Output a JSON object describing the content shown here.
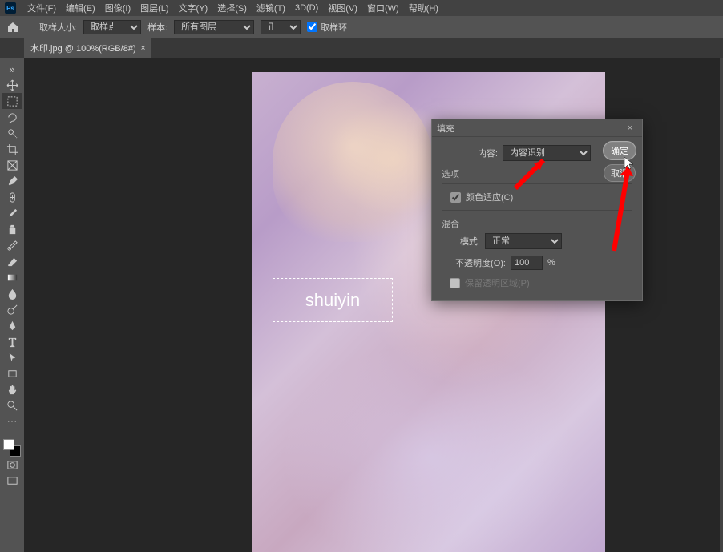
{
  "menu": {
    "items": [
      "文件(F)",
      "编辑(E)",
      "图像(I)",
      "图层(L)",
      "文字(Y)",
      "选择(S)",
      "滤镜(T)",
      "3D(D)",
      "视图(V)",
      "窗口(W)",
      "帮助(H)"
    ]
  },
  "optionsbar": {
    "sample_size_label": "取样大小:",
    "sample_size_value": "取样点",
    "sample_label": "样本:",
    "sample_value": "所有图层",
    "mode_value": "正常",
    "ring_label": "取样环"
  },
  "tab": {
    "label": "水印.jpg @ 100%(RGB/8#)"
  },
  "watermark_text": "shuiyin",
  "dialog": {
    "title": "填充",
    "content_label": "内容:",
    "content_value": "内容识别",
    "options_label": "选项",
    "color_adapt_label": "颜色适应(C)",
    "color_adapt_checked": true,
    "blend_label": "混合",
    "mode_label": "模式:",
    "mode_value": "正常",
    "opacity_label": "不透明度(O):",
    "opacity_value": "100",
    "opacity_unit": "%",
    "preserve_label": "保留透明区域(P)",
    "ok": "确定",
    "cancel": "取消"
  },
  "tools": [
    "move",
    "marquee",
    "lasso",
    "quick-select",
    "crop",
    "frame",
    "eyedropper",
    "healing",
    "brush",
    "clone",
    "history-brush",
    "eraser",
    "gradient",
    "blur",
    "dodge",
    "pen",
    "type",
    "path-select",
    "rectangle",
    "hand",
    "zoom"
  ]
}
